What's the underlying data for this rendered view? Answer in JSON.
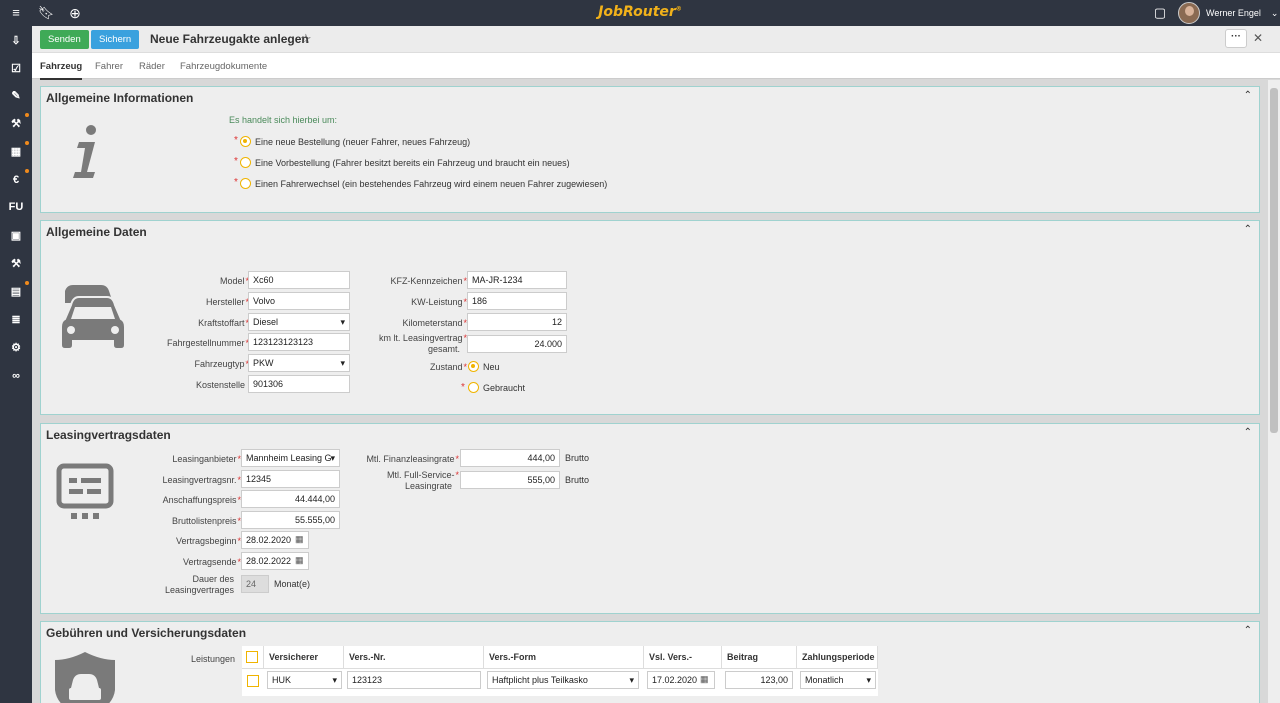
{
  "header": {
    "brand": "JobRouter",
    "brand_mark": "®",
    "user_name": "Werner Engel"
  },
  "toolbar": {
    "send_label": "Senden",
    "save_label": "Sichern",
    "title": "Neue Fahrzeugakte anlegen",
    "more_label": "···"
  },
  "tabs": [
    {
      "label": "Fahrzeug",
      "active": true
    },
    {
      "label": "Fahrer"
    },
    {
      "label": "Räder"
    },
    {
      "label": "Fahrzeugdokumente"
    }
  ],
  "sidebar": {
    "items": [
      {
        "icon": "inbox-download-icon",
        "glyph": "⇩"
      },
      {
        "icon": "check-box-icon",
        "glyph": "☑"
      },
      {
        "icon": "document-edit-icon",
        "glyph": "✎"
      },
      {
        "icon": "hammer-icon",
        "glyph": "⚒",
        "badge": true
      },
      {
        "icon": "table-icon",
        "glyph": "▦",
        "badge": true
      },
      {
        "icon": "euro-icon",
        "glyph": "€",
        "badge": true
      },
      {
        "icon": "fu-icon",
        "glyph": "FU"
      },
      {
        "icon": "contact-card-icon",
        "glyph": "▣"
      },
      {
        "icon": "hammer-icon",
        "glyph": "⚒"
      },
      {
        "icon": "clipboard-icon",
        "glyph": "▤",
        "badge": true
      },
      {
        "icon": "list-icon",
        "glyph": "≣"
      },
      {
        "icon": "wrench-icon",
        "glyph": "⚙"
      },
      {
        "icon": "link-icon",
        "glyph": "∞"
      }
    ]
  },
  "allgemeine_informationen": {
    "title": "Allgemeine Informationen",
    "question": "Es handelt sich hierbei um:",
    "options": [
      {
        "label": "Eine neue Bestellung (neuer Fahrer, neues Fahrzeug)",
        "selected": true
      },
      {
        "label": "Eine Vorbestellung (Fahrer besitzt bereits ein Fahrzeug und braucht ein neues)",
        "selected": false
      },
      {
        "label": "Einen Fahrerwechsel (ein bestehendes Fahrzeug wird einem neuen Fahrer zugewiesen)",
        "selected": false
      }
    ]
  },
  "allgemeine_daten": {
    "title": "Allgemeine Daten",
    "model_label": "Model",
    "model": "Xc60",
    "hersteller_label": "Hersteller",
    "hersteller": "Volvo",
    "kraftstoff_label": "Kraftstoffart",
    "kraftstoff": "Diesel",
    "fgnr_label": "Fahrgestellnummer",
    "fgnr": "123123123123",
    "typ_label": "Fahrzeugtyp",
    "typ": "PKW",
    "kostenstelle_label": "Kostenstelle",
    "kostenstelle": "901306",
    "kennzeichen_label": "KFZ-Kennzeichen",
    "kennzeichen": "MA-JR-1234",
    "kw_label": "KW-Leistung",
    "kw": "186",
    "km_label": "Kilometerstand",
    "km": "12",
    "km_leasing_label_1": "km lt. Leasingvertrag",
    "km_leasing_label_2": "gesamt.",
    "km_leasing": "24.000",
    "zustand_label": "Zustand",
    "zustand_neu": "Neu",
    "zustand_gebraucht": "Gebraucht"
  },
  "leasing": {
    "title": "Leasingvertragsdaten",
    "anbieter_label": "Leasinganbieter",
    "anbieter": "Mannheim Leasing G",
    "vnr_label": "Leasingvertragsnr.",
    "vnr": "12345",
    "anschaffung_label": "Anschaffungspreis",
    "anschaffung": "44.444,00",
    "brutto_label": "Bruttolistenpreis",
    "brutto": "55.555,00",
    "beginn_label": "Vertragsbeginn",
    "beginn": "28.02.2020",
    "ende_label": "Vertragsende",
    "ende": "28.02.2022",
    "dauer_label_1": "Dauer des",
    "dauer_label_2": "Leasingvertrages",
    "dauer": "24",
    "dauer_unit": "Monat(e)",
    "finanz_label": "Mtl. Finanzleasingrate",
    "finanz": "444,00",
    "finanz_unit": "Brutto",
    "service_label_1": "Mtl. Full-Service-",
    "service_label_2": "Leasingrate",
    "service": "555,00",
    "service_unit": "Brutto"
  },
  "gebuehren": {
    "title": "Gebühren und Versicherungsdaten",
    "leistungen_label": "Leistungen",
    "columns": [
      "Versicherer",
      "Vers.-Nr.",
      "Vers.-Form",
      "Vsl. Vers.-Beginn",
      "Beitrag",
      "Zahlungsperiode"
    ],
    "row": {
      "versicherer": "HUK",
      "vers_nr": "123123",
      "vers_form": "Haftplicht plus Teilkasko",
      "beginn": "17.02.2020",
      "beitrag": "123,00",
      "periode": "Monatlich"
    }
  }
}
